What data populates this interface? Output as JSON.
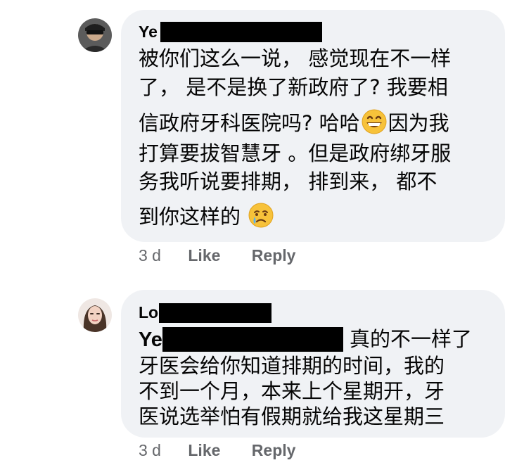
{
  "comments": [
    {
      "author": "Ye",
      "lines": [
        "被你们这么一说， 感觉现在不一样",
        "了， 是不是换了新政府了? 我要相",
        "信政府牙科医院吗? 哈哈",
        "因为我",
        "打算要拔智慧牙 。但是政府绑牙服",
        "务我听说要排期， 排到来， 都不",
        "到你这样的 "
      ],
      "emoji_names": [
        "grinning-face-emoji",
        "crying-face-emoji"
      ],
      "time": "3 d",
      "like": "Like",
      "reply": "Reply"
    },
    {
      "author": "Lo",
      "mention": "Ye",
      "lines": [
        "真的不一样了",
        "牙医会给你知道排期的时间，我的",
        "不到一个月，本来上个星期开，牙",
        "医说选举怕有假期就给我这星期三"
      ],
      "time": "3 d",
      "like": "Like",
      "reply": "Reply"
    }
  ],
  "colors": {
    "bubble": "#f0f2f5",
    "text": "#050505",
    "meta": "#65676b",
    "redaction": "#000000"
  }
}
